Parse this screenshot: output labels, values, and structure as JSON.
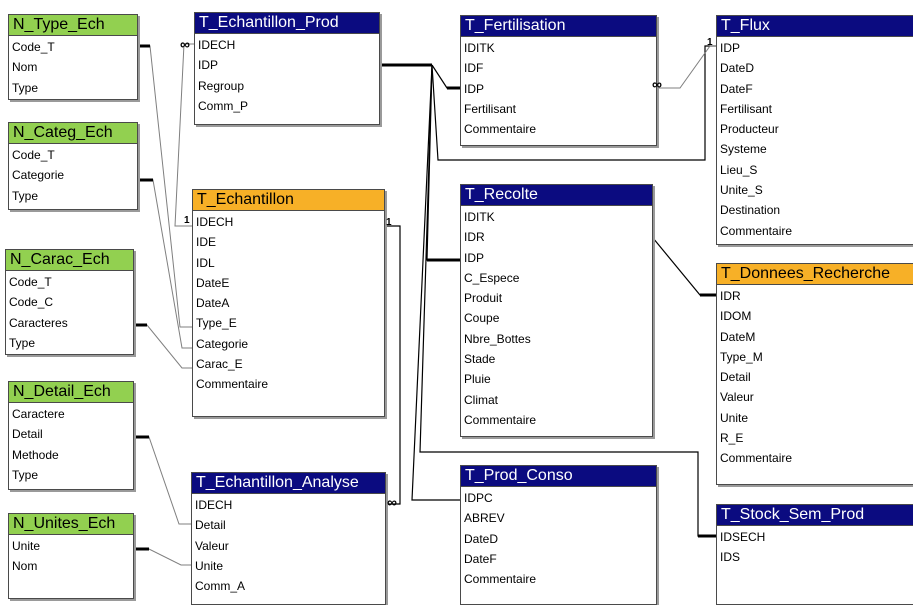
{
  "tables": {
    "n_type_ech": {
      "title": "N_Type_Ech",
      "fields": [
        "Code_T",
        "Nom",
        "Type"
      ]
    },
    "n_categ_ech": {
      "title": "N_Categ_Ech",
      "fields": [
        "Code_T",
        "Categorie",
        "Type"
      ]
    },
    "n_carac_ech": {
      "title": "N_Carac_Ech",
      "fields": [
        "Code_T",
        "Code_C",
        "Caracteres",
        "Type"
      ]
    },
    "n_detail_ech": {
      "title": "N_Detail_Ech",
      "fields": [
        "Caractere",
        "Detail",
        "Methode",
        "Type"
      ]
    },
    "n_unites_ech": {
      "title": "N_Unites_Ech",
      "fields": [
        "Unite",
        "Nom"
      ]
    },
    "t_echantillon_prod": {
      "title": "T_Echantillon_Prod",
      "fields": [
        "IDECH",
        "IDP",
        "Regroup",
        "Comm_P"
      ]
    },
    "t_echantillon": {
      "title": "T_Echantillon",
      "fields": [
        "IDECH",
        "IDE",
        "IDL",
        "DateE",
        "DateA",
        "Type_E",
        "Categorie",
        "Carac_E",
        "Commentaire"
      ]
    },
    "t_echantillon_analyse": {
      "title": "T_Echantillon_Analyse",
      "fields": [
        "IDECH",
        "Detail",
        "Valeur",
        "Unite",
        "Comm_A"
      ]
    },
    "t_fertilisation": {
      "title": "T_Fertilisation",
      "fields": [
        "IDITK",
        "IDF",
        "IDP",
        "Fertilisant",
        "Commentaire"
      ]
    },
    "t_recolte": {
      "title": "T_Recolte",
      "fields": [
        "IDITK",
        "IDR",
        "IDP",
        "C_Espece",
        "Produit",
        "Coupe",
        "Nbre_Bottes",
        "Stade",
        "Pluie",
        "Climat",
        "Commentaire"
      ]
    },
    "t_prod_conso": {
      "title": "T_Prod_Conso",
      "fields": [
        "IDPC",
        "ABREV",
        "DateD",
        "DateF",
        "Commentaire"
      ]
    },
    "t_flux": {
      "title": "T_Flux",
      "fields": [
        "IDP",
        "DateD",
        "DateF",
        "Fertilisant",
        "Producteur",
        "Systeme",
        "Lieu_S",
        "Unite_S",
        "Destination",
        "Commentaire"
      ]
    },
    "t_donnees_recherche": {
      "title": "T_Donnees_Recherche",
      "fields": [
        "IDR",
        "IDOM",
        "DateM",
        "Type_M",
        "Detail",
        "Valeur",
        "Unite",
        "R_E",
        "Commentaire"
      ]
    },
    "t_stock_sem_prod": {
      "title": "T_Stock_Sem_Prod",
      "fields": [
        "IDSECH",
        "IDS"
      ]
    }
  },
  "cardinality": {
    "one": "1",
    "many": "∞"
  },
  "colors": {
    "t_header": "#0b0b80",
    "n_header": "#92d050",
    "main_header": "#f7b027",
    "line": "#000000",
    "grey_line": "#7f7f7f"
  }
}
